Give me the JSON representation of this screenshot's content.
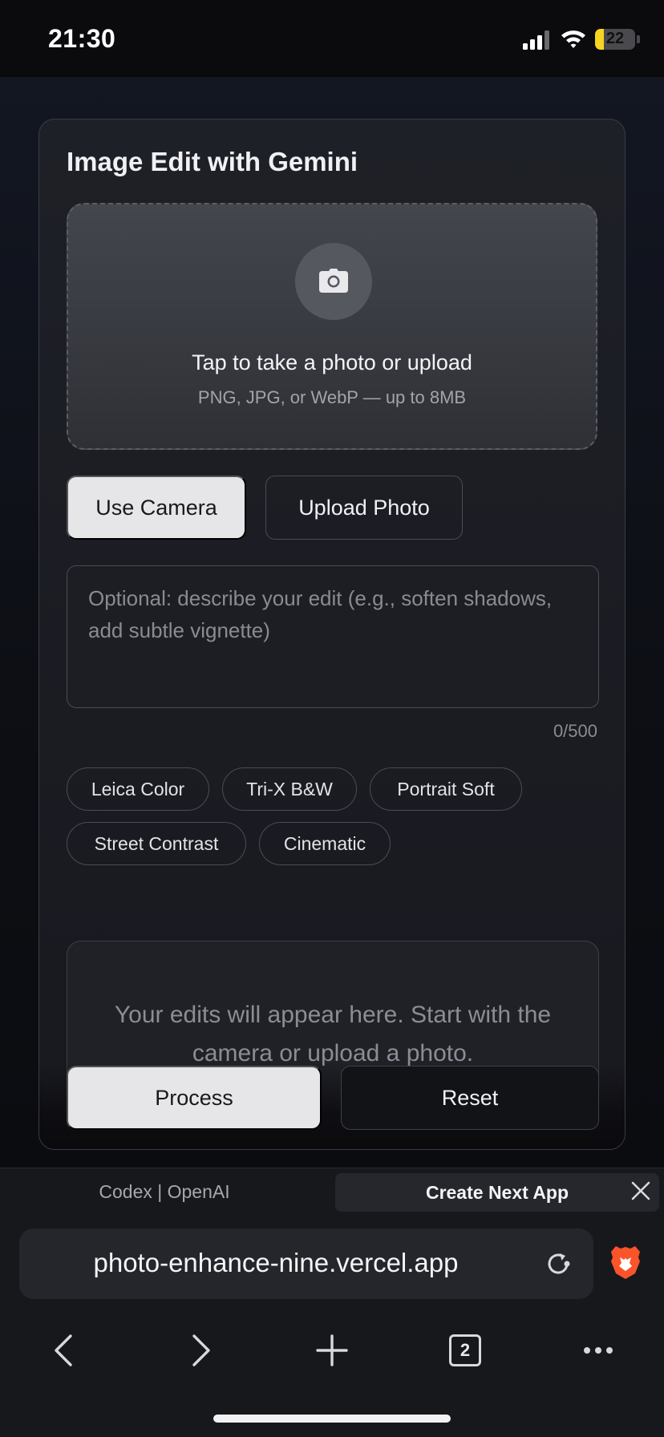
{
  "status": {
    "time": "21:30",
    "battery": "22",
    "battery_level": 0.22
  },
  "app": {
    "title": "Image Edit with Gemini",
    "dropzone": {
      "title": "Tap to take a photo or upload",
      "subtitle": "PNG, JPG, or WebP — up to 8MB"
    },
    "buttons": {
      "camera": "Use Camera",
      "upload": "Upload Photo",
      "process": "Process",
      "reset": "Reset"
    },
    "prompt": {
      "placeholder": "Optional: describe your edit (e.g., soften shadows, add subtle vignette)",
      "counter": "0/500"
    },
    "presets": [
      "Leica Color",
      "Tri-X B&W",
      "Portrait Soft",
      "Street Contrast",
      "Cinematic"
    ],
    "result_placeholder": "Your edits will appear here. Start with the camera or upload a photo."
  },
  "browser": {
    "tabs": [
      "Codex | OpenAI",
      "Create Next App"
    ],
    "url": "photo-enhance-nine.vercel.app",
    "tab_count": "2"
  }
}
